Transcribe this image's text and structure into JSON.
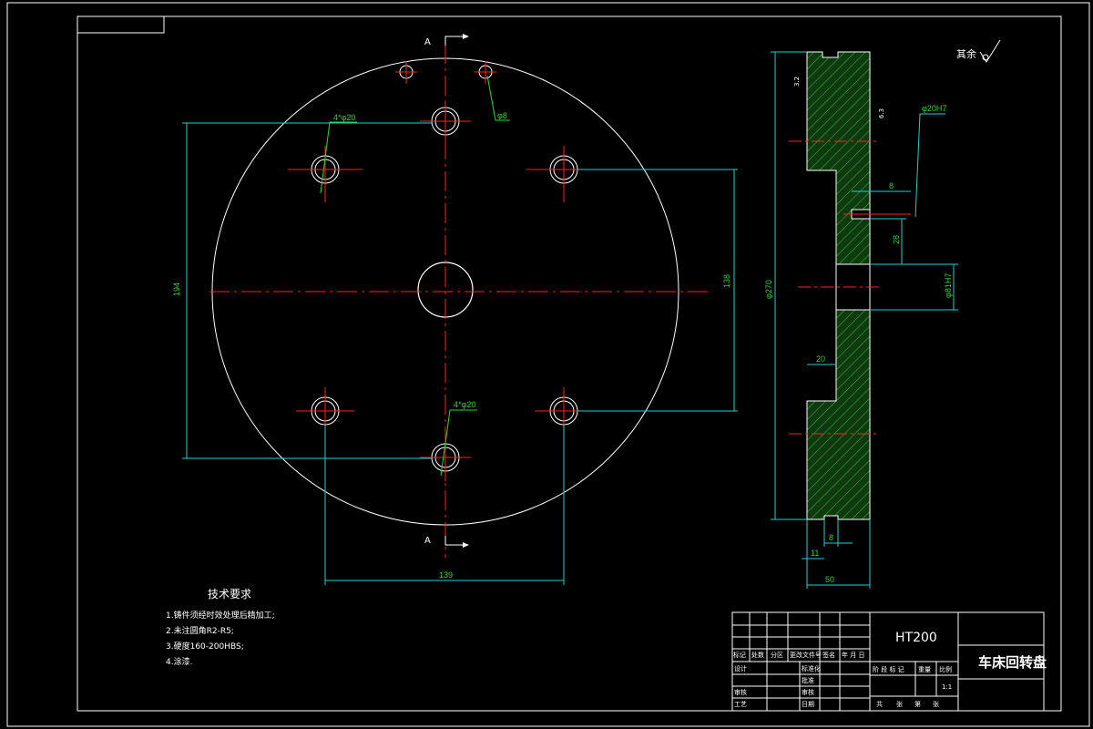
{
  "section_marks": {
    "top": "A",
    "bottom": "A"
  },
  "front_view": {
    "hole_callout_upper": "4*φ20",
    "hole_callout_lower": "4*φ20",
    "small_hole_callout": "φ8",
    "dim_vertical_left": "194",
    "dim_vertical_right": "138",
    "dim_horizontal_bottom": "139"
  },
  "section_view": {
    "dim_diameter": "φ270",
    "dim_bore_upper": "φ20H7",
    "dim_bore_center": "φ81H7",
    "dim_groove_top": "8",
    "dim_groove_bottom": "8",
    "dim_offset": "28",
    "dim_recess_depth": "20",
    "dim_hub": "11",
    "dim_thickness": "50",
    "roughness_mark_1": "3.2",
    "roughness_mark_2": "6.3"
  },
  "roughness_note": "其余",
  "tech_requirements": {
    "title": "技术要求",
    "items": [
      "1.铸件须经时效处理后精加工;",
      "2.未注圆角R2-R5;",
      "3.硬度160-200HBS;",
      "4.涂漆."
    ]
  },
  "title_block": {
    "material": "HT200",
    "part_name": "车床回转盘",
    "revision_headers": [
      "标记",
      "处数",
      "分区",
      "更改文件号",
      "签名",
      "年 月 日"
    ],
    "roles": [
      "设计",
      "审核",
      "工艺"
    ],
    "role_mid": [
      "标准化",
      "批准",
      "审核",
      "日期"
    ],
    "stage_headers": [
      "阶 段 标 记",
      "重量",
      "比例"
    ],
    "scale": "1:1",
    "sheet_row": [
      "共",
      "张",
      "第",
      "张"
    ]
  }
}
